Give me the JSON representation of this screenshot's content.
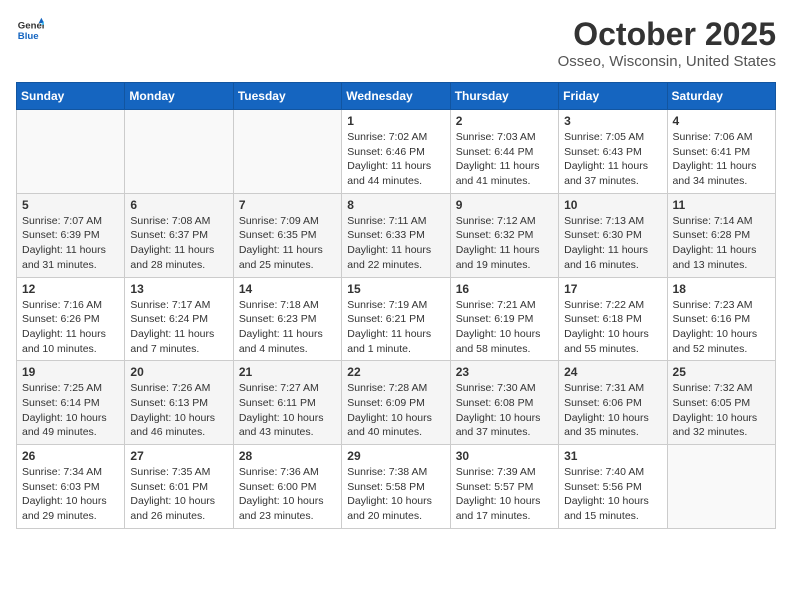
{
  "header": {
    "logo_general": "General",
    "logo_blue": "Blue",
    "month": "October 2025",
    "location": "Osseo, Wisconsin, United States"
  },
  "days_of_week": [
    "Sunday",
    "Monday",
    "Tuesday",
    "Wednesday",
    "Thursday",
    "Friday",
    "Saturday"
  ],
  "rows": [
    [
      {
        "day": "",
        "sunrise": "",
        "sunset": "",
        "daylight": ""
      },
      {
        "day": "",
        "sunrise": "",
        "sunset": "",
        "daylight": ""
      },
      {
        "day": "",
        "sunrise": "",
        "sunset": "",
        "daylight": ""
      },
      {
        "day": "1",
        "sunrise": "Sunrise: 7:02 AM",
        "sunset": "Sunset: 6:46 PM",
        "daylight": "Daylight: 11 hours and 44 minutes."
      },
      {
        "day": "2",
        "sunrise": "Sunrise: 7:03 AM",
        "sunset": "Sunset: 6:44 PM",
        "daylight": "Daylight: 11 hours and 41 minutes."
      },
      {
        "day": "3",
        "sunrise": "Sunrise: 7:05 AM",
        "sunset": "Sunset: 6:43 PM",
        "daylight": "Daylight: 11 hours and 37 minutes."
      },
      {
        "day": "4",
        "sunrise": "Sunrise: 7:06 AM",
        "sunset": "Sunset: 6:41 PM",
        "daylight": "Daylight: 11 hours and 34 minutes."
      }
    ],
    [
      {
        "day": "5",
        "sunrise": "Sunrise: 7:07 AM",
        "sunset": "Sunset: 6:39 PM",
        "daylight": "Daylight: 11 hours and 31 minutes."
      },
      {
        "day": "6",
        "sunrise": "Sunrise: 7:08 AM",
        "sunset": "Sunset: 6:37 PM",
        "daylight": "Daylight: 11 hours and 28 minutes."
      },
      {
        "day": "7",
        "sunrise": "Sunrise: 7:09 AM",
        "sunset": "Sunset: 6:35 PM",
        "daylight": "Daylight: 11 hours and 25 minutes."
      },
      {
        "day": "8",
        "sunrise": "Sunrise: 7:11 AM",
        "sunset": "Sunset: 6:33 PM",
        "daylight": "Daylight: 11 hours and 22 minutes."
      },
      {
        "day": "9",
        "sunrise": "Sunrise: 7:12 AM",
        "sunset": "Sunset: 6:32 PM",
        "daylight": "Daylight: 11 hours and 19 minutes."
      },
      {
        "day": "10",
        "sunrise": "Sunrise: 7:13 AM",
        "sunset": "Sunset: 6:30 PM",
        "daylight": "Daylight: 11 hours and 16 minutes."
      },
      {
        "day": "11",
        "sunrise": "Sunrise: 7:14 AM",
        "sunset": "Sunset: 6:28 PM",
        "daylight": "Daylight: 11 hours and 13 minutes."
      }
    ],
    [
      {
        "day": "12",
        "sunrise": "Sunrise: 7:16 AM",
        "sunset": "Sunset: 6:26 PM",
        "daylight": "Daylight: 11 hours and 10 minutes."
      },
      {
        "day": "13",
        "sunrise": "Sunrise: 7:17 AM",
        "sunset": "Sunset: 6:24 PM",
        "daylight": "Daylight: 11 hours and 7 minutes."
      },
      {
        "day": "14",
        "sunrise": "Sunrise: 7:18 AM",
        "sunset": "Sunset: 6:23 PM",
        "daylight": "Daylight: 11 hours and 4 minutes."
      },
      {
        "day": "15",
        "sunrise": "Sunrise: 7:19 AM",
        "sunset": "Sunset: 6:21 PM",
        "daylight": "Daylight: 11 hours and 1 minute."
      },
      {
        "day": "16",
        "sunrise": "Sunrise: 7:21 AM",
        "sunset": "Sunset: 6:19 PM",
        "daylight": "Daylight: 10 hours and 58 minutes."
      },
      {
        "day": "17",
        "sunrise": "Sunrise: 7:22 AM",
        "sunset": "Sunset: 6:18 PM",
        "daylight": "Daylight: 10 hours and 55 minutes."
      },
      {
        "day": "18",
        "sunrise": "Sunrise: 7:23 AM",
        "sunset": "Sunset: 6:16 PM",
        "daylight": "Daylight: 10 hours and 52 minutes."
      }
    ],
    [
      {
        "day": "19",
        "sunrise": "Sunrise: 7:25 AM",
        "sunset": "Sunset: 6:14 PM",
        "daylight": "Daylight: 10 hours and 49 minutes."
      },
      {
        "day": "20",
        "sunrise": "Sunrise: 7:26 AM",
        "sunset": "Sunset: 6:13 PM",
        "daylight": "Daylight: 10 hours and 46 minutes."
      },
      {
        "day": "21",
        "sunrise": "Sunrise: 7:27 AM",
        "sunset": "Sunset: 6:11 PM",
        "daylight": "Daylight: 10 hours and 43 minutes."
      },
      {
        "day": "22",
        "sunrise": "Sunrise: 7:28 AM",
        "sunset": "Sunset: 6:09 PM",
        "daylight": "Daylight: 10 hours and 40 minutes."
      },
      {
        "day": "23",
        "sunrise": "Sunrise: 7:30 AM",
        "sunset": "Sunset: 6:08 PM",
        "daylight": "Daylight: 10 hours and 37 minutes."
      },
      {
        "day": "24",
        "sunrise": "Sunrise: 7:31 AM",
        "sunset": "Sunset: 6:06 PM",
        "daylight": "Daylight: 10 hours and 35 minutes."
      },
      {
        "day": "25",
        "sunrise": "Sunrise: 7:32 AM",
        "sunset": "Sunset: 6:05 PM",
        "daylight": "Daylight: 10 hours and 32 minutes."
      }
    ],
    [
      {
        "day": "26",
        "sunrise": "Sunrise: 7:34 AM",
        "sunset": "Sunset: 6:03 PM",
        "daylight": "Daylight: 10 hours and 29 minutes."
      },
      {
        "day": "27",
        "sunrise": "Sunrise: 7:35 AM",
        "sunset": "Sunset: 6:01 PM",
        "daylight": "Daylight: 10 hours and 26 minutes."
      },
      {
        "day": "28",
        "sunrise": "Sunrise: 7:36 AM",
        "sunset": "Sunset: 6:00 PM",
        "daylight": "Daylight: 10 hours and 23 minutes."
      },
      {
        "day": "29",
        "sunrise": "Sunrise: 7:38 AM",
        "sunset": "Sunset: 5:58 PM",
        "daylight": "Daylight: 10 hours and 20 minutes."
      },
      {
        "day": "30",
        "sunrise": "Sunrise: 7:39 AM",
        "sunset": "Sunset: 5:57 PM",
        "daylight": "Daylight: 10 hours and 17 minutes."
      },
      {
        "day": "31",
        "sunrise": "Sunrise: 7:40 AM",
        "sunset": "Sunset: 5:56 PM",
        "daylight": "Daylight: 10 hours and 15 minutes."
      },
      {
        "day": "",
        "sunrise": "",
        "sunset": "",
        "daylight": ""
      }
    ]
  ]
}
